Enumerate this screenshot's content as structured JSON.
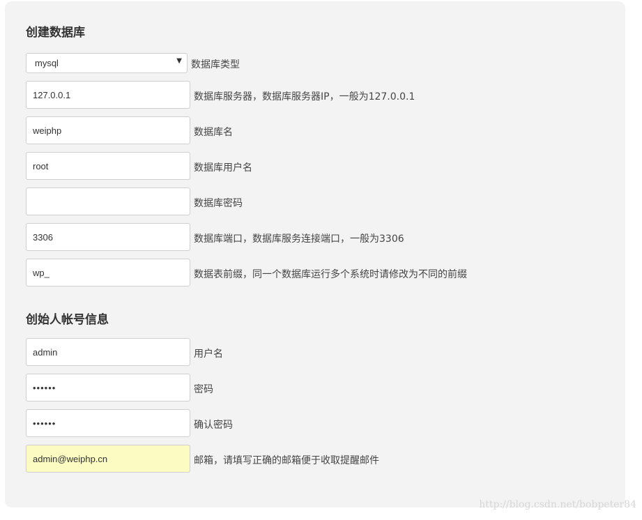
{
  "db_section": {
    "title": "创建数据库",
    "db_type": {
      "value": "mysql",
      "label": "数据库类型"
    },
    "db_host": {
      "value": "127.0.0.1",
      "label": "数据库服务器，数据库服务器IP，一般为127.0.0.1"
    },
    "db_name": {
      "value": "weiphp",
      "label": "数据库名"
    },
    "db_user": {
      "value": "root",
      "label": "数据库用户名"
    },
    "db_password": {
      "value": "",
      "label": "数据库密码"
    },
    "db_port": {
      "value": "3306",
      "label": "数据库端口，数据库服务连接端口，一般为3306"
    },
    "db_prefix": {
      "value": "wp_",
      "label": "数据表前缀，同一个数据库运行多个系统时请修改为不同的前缀"
    }
  },
  "admin_section": {
    "title": "创始人帐号信息",
    "username": {
      "value": "admin",
      "label": "用户名"
    },
    "password": {
      "value": "••••••",
      "label": "密码"
    },
    "confirm_password": {
      "value": "••••••",
      "label": "确认密码"
    },
    "email": {
      "value": "admin@weiphp.cn",
      "label": "邮箱，请填写正确的邮箱便于收取提醒邮件"
    }
  },
  "watermark": "http://blog.csdn.net/bobpeter84",
  "colors": {
    "panel_bg": "#f3f3f3",
    "autofill_bg": "#fbfbc2",
    "input_border": "#cfcfcf"
  },
  "icons": {
    "select_arrow": "triangle-down-icon"
  }
}
